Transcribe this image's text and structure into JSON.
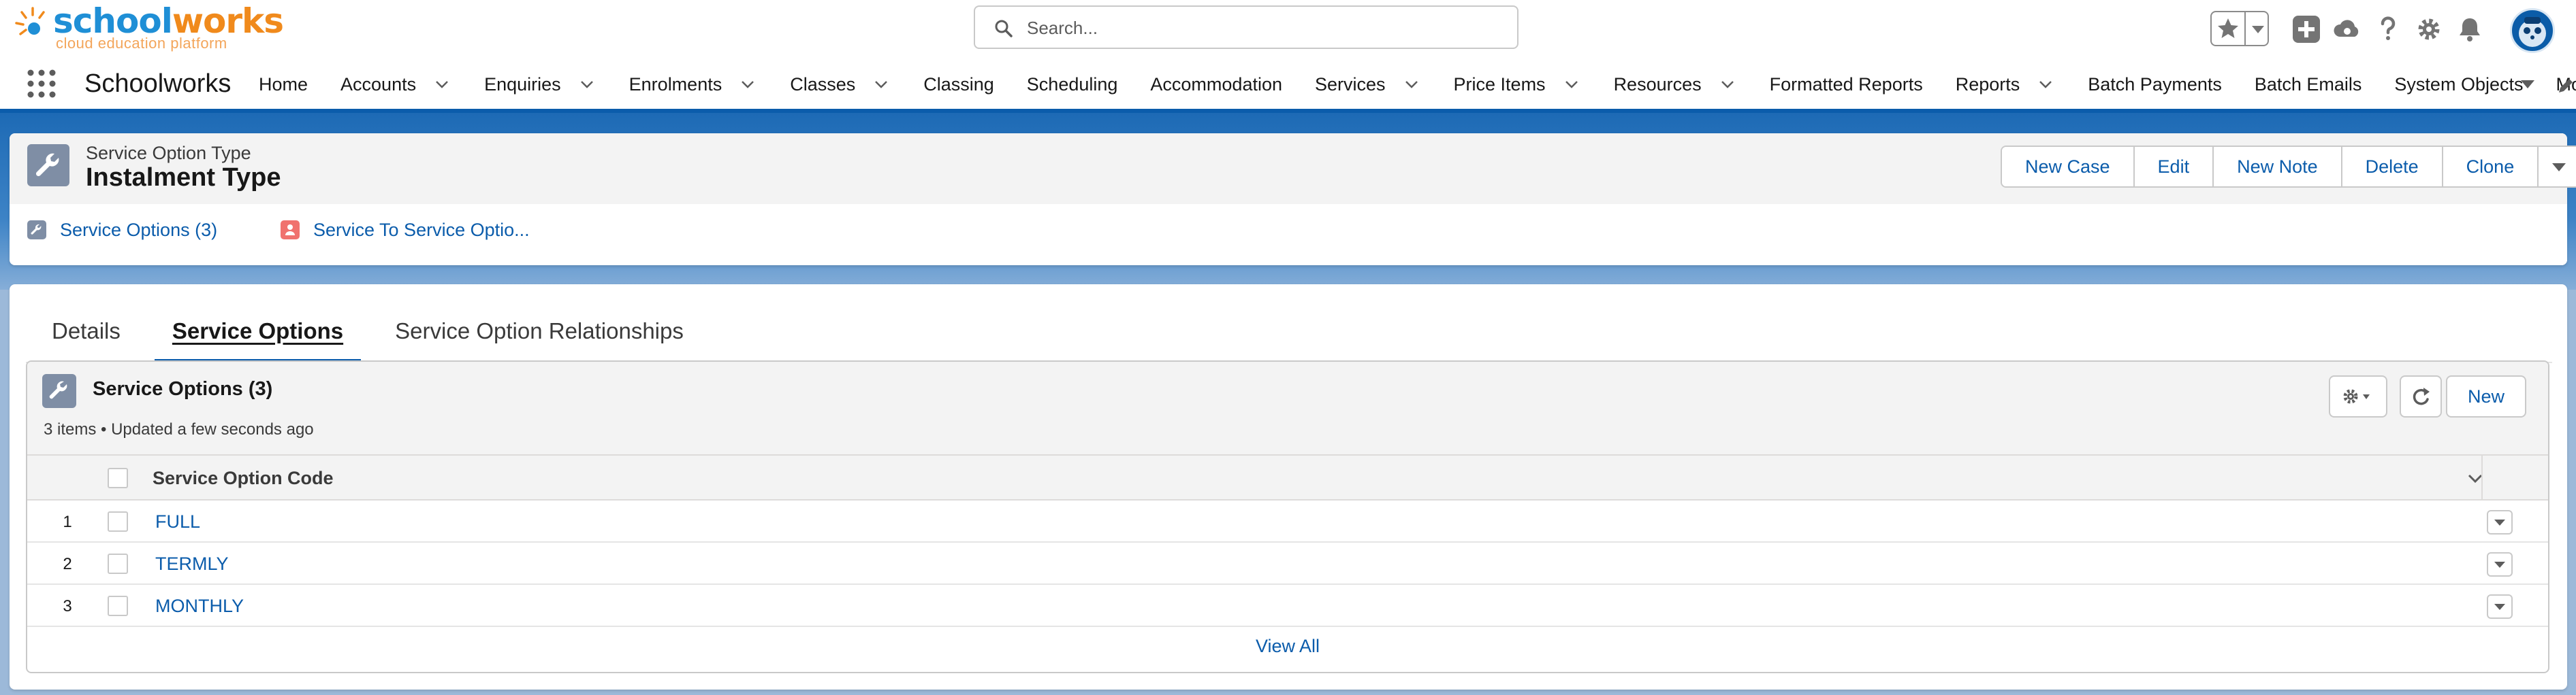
{
  "brand": {
    "logo_primary_part1": "school",
    "logo_primary_part2": "works",
    "logo_tagline": "cloud education platform",
    "logo_color_blue": "#1f8fd6",
    "logo_color_orange": "#f08a1c"
  },
  "search": {
    "placeholder": "Search..."
  },
  "header_icons": [
    "star-icon",
    "chevron-down-icon",
    "add-icon",
    "cloud-icon",
    "help-icon",
    "gear-icon",
    "bell-icon",
    "avatar"
  ],
  "nav": {
    "app_name": "Schoolworks",
    "items": [
      {
        "label": "Home",
        "dropdown": false
      },
      {
        "label": "Accounts",
        "dropdown": true
      },
      {
        "label": "Enquiries",
        "dropdown": true
      },
      {
        "label": "Enrolments",
        "dropdown": true
      },
      {
        "label": "Classes",
        "dropdown": true
      },
      {
        "label": "Classing",
        "dropdown": false
      },
      {
        "label": "Scheduling",
        "dropdown": false
      },
      {
        "label": "Accommodation",
        "dropdown": false
      },
      {
        "label": "Services",
        "dropdown": true
      },
      {
        "label": "Price Items",
        "dropdown": true
      },
      {
        "label": "Resources",
        "dropdown": true
      },
      {
        "label": "Formatted Reports",
        "dropdown": false
      },
      {
        "label": "Reports",
        "dropdown": true
      },
      {
        "label": "Batch Payments",
        "dropdown": false
      },
      {
        "label": "Batch Emails",
        "dropdown": false
      },
      {
        "label": "System Objects",
        "dropdown": false
      },
      {
        "label": "More",
        "dropdown": true
      }
    ],
    "accent_color": "#0b5cab"
  },
  "record": {
    "object_label": "Service Option Type",
    "title": "Instalment Type",
    "actions": [
      "New Case",
      "Edit",
      "New Note",
      "Delete",
      "Clone"
    ],
    "related_links": [
      {
        "label": "Service Options (3)",
        "icon": "wrench-icon",
        "color": "#7f8ea5"
      },
      {
        "label": "Service To Service Optio...",
        "icon": "relationship-icon",
        "color": "#f0726e"
      }
    ]
  },
  "tabs": [
    {
      "label": "Details",
      "active": false
    },
    {
      "label": "Service Options",
      "active": true
    },
    {
      "label": "Service Option Relationships",
      "active": false
    }
  ],
  "related_list": {
    "title": "Service Options (3)",
    "meta": "3 items • Updated a few seconds ago",
    "new_label": "New",
    "column_header": "Service Option Code",
    "rows": [
      {
        "num": "1",
        "code": "FULL"
      },
      {
        "num": "2",
        "code": "TERMLY"
      },
      {
        "num": "3",
        "code": "MONTHLY"
      }
    ],
    "view_all": "View All"
  }
}
